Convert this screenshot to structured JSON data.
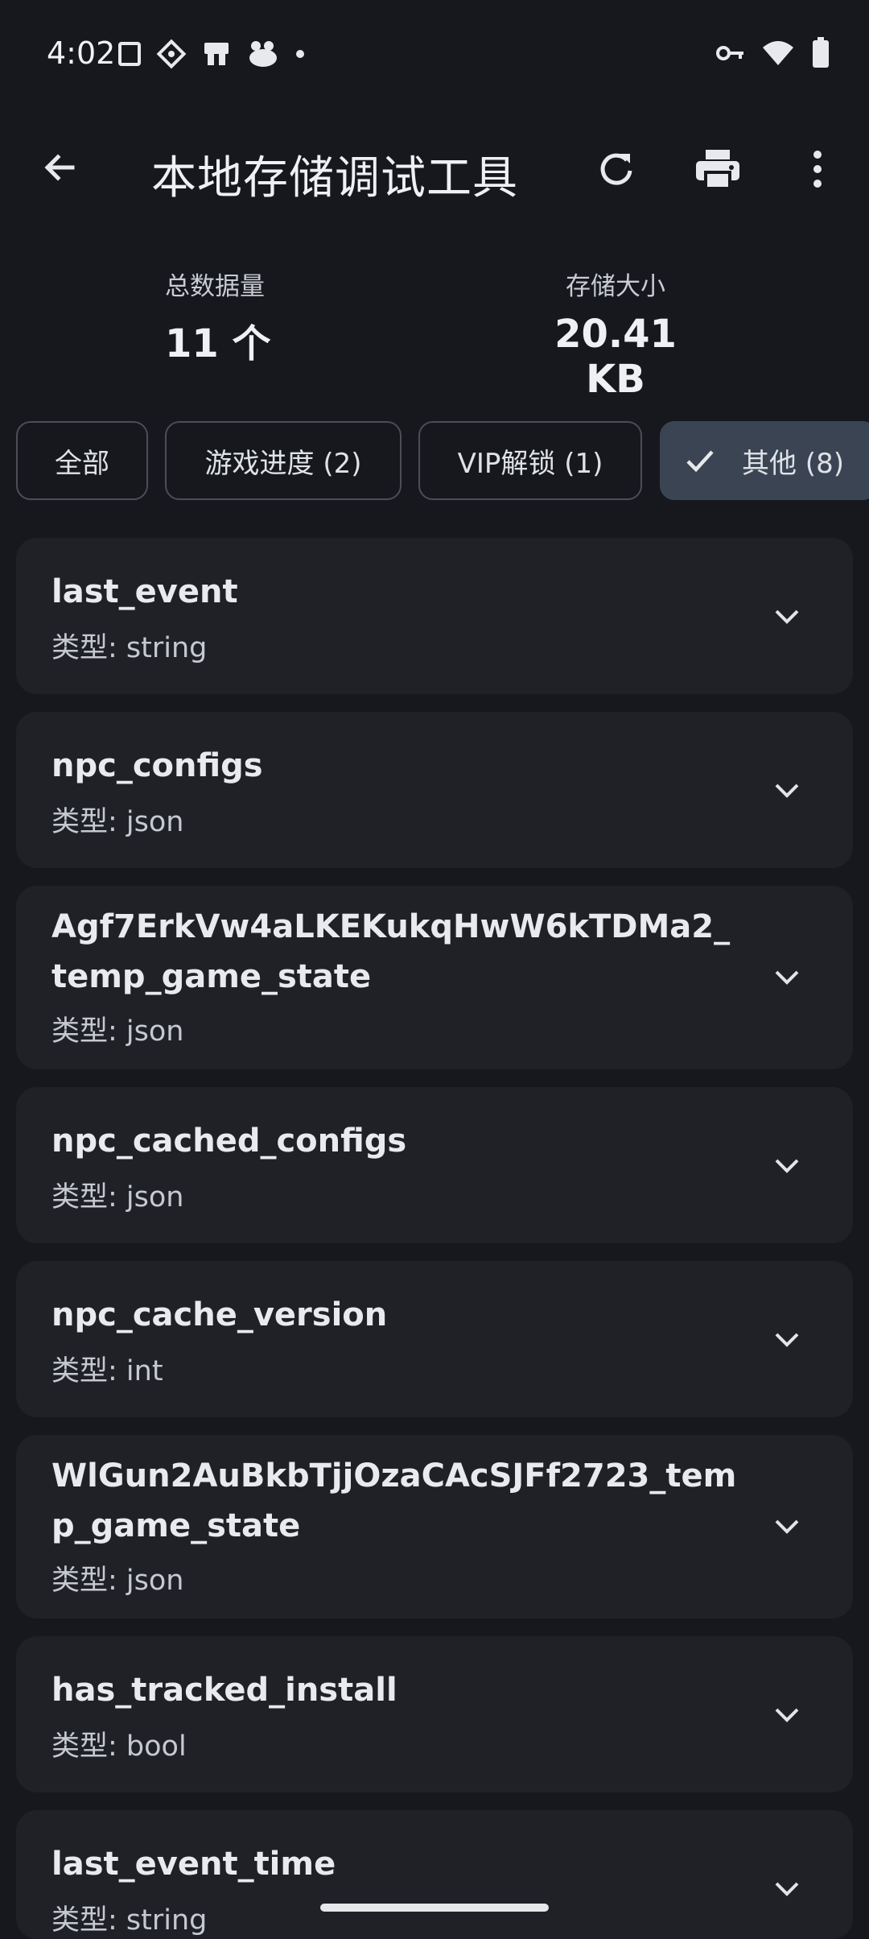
{
  "status": {
    "time": "4:02",
    "left_icons": [
      "screen-icon",
      "diamond-icon",
      "notification-icon",
      "notification-icon-2",
      "dot-icon"
    ],
    "right_icons": [
      "key-icon",
      "wifi-icon",
      "battery-icon"
    ]
  },
  "appbar": {
    "title": "本地存储调试工具",
    "actions": [
      "refresh-icon",
      "print-icon",
      "more-vert-icon"
    ]
  },
  "summary": {
    "total_label": "总数据量",
    "total_value": "11 个",
    "size_label": "存储大小",
    "size_value": "20.41 KB"
  },
  "chips": [
    {
      "label": "全部",
      "selected": false
    },
    {
      "label": "游戏进度 (2)",
      "selected": false
    },
    {
      "label": "VIP解锁 (1)",
      "selected": false
    },
    {
      "label": "其他 (8)",
      "selected": true
    }
  ],
  "items": [
    {
      "name": "last_event",
      "type": "类型: string"
    },
    {
      "name": "npc_configs",
      "type": "类型: json"
    },
    {
      "name": "Agf7ErkVw4aLKEKukqHwW6kTDMa2_temp_game_state",
      "type": "类型: json"
    },
    {
      "name": "npc_cached_configs",
      "type": "类型: json"
    },
    {
      "name": "npc_cache_version",
      "type": "类型: int"
    },
    {
      "name": "WlGun2AuBkbTjjOzaCAcSJFf2723_temp_game_state",
      "type": "类型: json"
    },
    {
      "name": "has_tracked_install",
      "type": "类型: bool"
    },
    {
      "name": "last_event_time",
      "type": "类型: string"
    }
  ],
  "colors": {
    "background": "#16181d",
    "card": "#1f2127",
    "chip_selected": "#3b4453"
  }
}
